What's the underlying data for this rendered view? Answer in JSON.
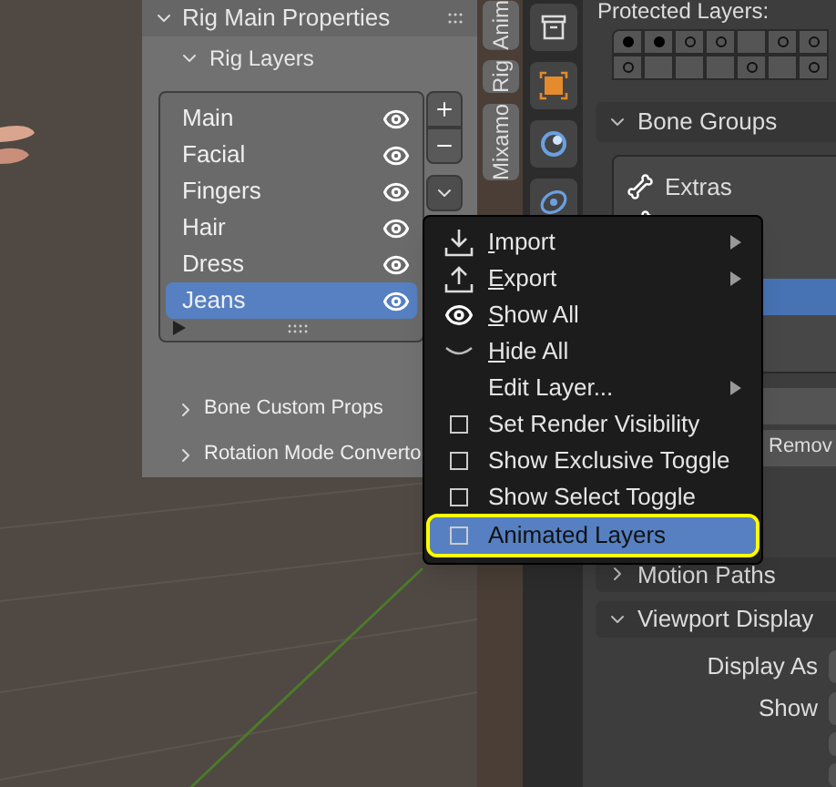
{
  "left_panel": {
    "title": "Rig Main Properties",
    "subpanel": {
      "title": "Rig Layers",
      "expanded": true
    },
    "layers": [
      {
        "name": "Main",
        "visible": true,
        "selected": false
      },
      {
        "name": "Facial",
        "visible": true,
        "selected": false
      },
      {
        "name": "Fingers",
        "visible": true,
        "selected": false
      },
      {
        "name": "Hair",
        "visible": true,
        "selected": false
      },
      {
        "name": "Dress",
        "visible": true,
        "selected": false
      },
      {
        "name": "Jeans",
        "visible": true,
        "selected": true
      }
    ],
    "collapsed_panels": [
      {
        "title": "Bone Custom Props",
        "expanded": false
      },
      {
        "title": "Rotation Mode Converto",
        "expanded": false
      }
    ]
  },
  "side_tabs": [
    {
      "label": "Anim"
    },
    {
      "label": "Rig"
    },
    {
      "label": "Mixamo"
    }
  ],
  "context_menu": {
    "items": [
      {
        "kind": "import",
        "label": "Import",
        "submenu": true,
        "selected": false
      },
      {
        "kind": "export",
        "label": "Export",
        "submenu": true,
        "selected": false
      },
      {
        "kind": "show",
        "label": "Show All",
        "submenu": false,
        "selected": false
      },
      {
        "kind": "hide",
        "label": "Hide All",
        "submenu": false,
        "selected": false
      },
      {
        "kind": "plain",
        "label": "Edit Layer...",
        "submenu": true,
        "selected": false
      },
      {
        "kind": "checkbox",
        "label": "Set Render Visibility",
        "checked": false,
        "submenu": false,
        "selected": false
      },
      {
        "kind": "checkbox",
        "label": "Show Exclusive Toggle",
        "checked": false,
        "submenu": false,
        "selected": false
      },
      {
        "kind": "checkbox",
        "label": "Show Select Toggle",
        "checked": false,
        "submenu": false,
        "selected": false
      },
      {
        "kind": "checkbox",
        "label": "Animated Layers",
        "checked": false,
        "submenu": false,
        "selected": true
      }
    ]
  },
  "properties": {
    "protected_layers": {
      "label": "Protected Layers:",
      "rows": [
        [
          {
            "used": true,
            "protected": true
          },
          {
            "used": true,
            "protected": true
          },
          {
            "used": true,
            "protected": false
          },
          {
            "used": true,
            "protected": false
          },
          {
            "used": false
          },
          {
            "used": true,
            "protected": false
          },
          {
            "used": true,
            "protected": false
          }
        ],
        [
          {
            "used": true,
            "protected": false
          },
          {
            "used": false
          },
          {
            "used": false
          },
          {
            "used": false
          },
          {
            "used": true,
            "protected": false
          },
          {
            "used": false
          },
          {
            "used": true,
            "protected": false
          }
        ]
      ]
    },
    "bone_groups": {
      "title": "Bone Groups",
      "expanded": true,
      "groups": [
        {
          "name": "Extras",
          "selected": false
        },
        {
          "selected": false
        },
        {
          "selected": false
        },
        {
          "selected": true
        },
        {
          "selected": false
        }
      ],
      "buttons": [
        "Remov"
      ]
    },
    "motion_paths": {
      "title": "Motion Paths",
      "expanded": false
    },
    "viewport_display": {
      "title": "Viewport Display",
      "expanded": true,
      "fields": [
        {
          "label": "Display As"
        },
        {
          "label": "Show"
        }
      ]
    }
  }
}
